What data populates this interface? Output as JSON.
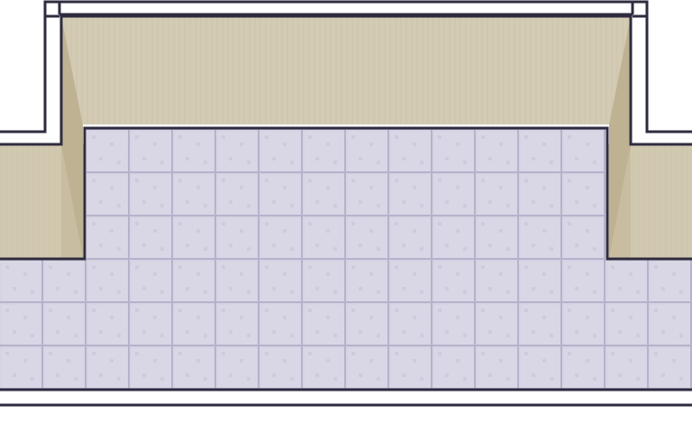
{
  "scene": {
    "type": "top-down tile map",
    "description_visible_text": ""
  },
  "palette": {
    "wall_top": "#d3cbb4",
    "wall_top_stripe": "#cfc7ae",
    "wall_side": "#bfb293",
    "wall_side_dark": "#b3a686",
    "floor_tile": "#d6d3e2",
    "floor_tile_edge": "#b7b1cc",
    "outline": "#2f2b3f",
    "background": "#ffffff"
  },
  "tiles": {
    "floor_tile_size_px": 48
  }
}
